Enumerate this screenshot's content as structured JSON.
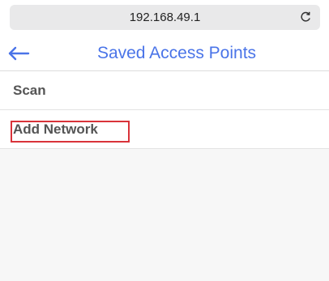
{
  "browser": {
    "url": "192.168.49.1",
    "reload_icon": "reload-icon"
  },
  "header": {
    "back_icon": "left-arrow-icon",
    "title": "Saved Access Points"
  },
  "menu": {
    "items": [
      {
        "label": "Scan"
      },
      {
        "label": "Add Network",
        "highlighted": true
      }
    ]
  },
  "colors": {
    "accent": "#4a74e8",
    "highlight_border": "#d9333a",
    "url_bar_bg": "#e9e9ea",
    "menu_bg": "#f7f7f7",
    "item_text": "#555555"
  }
}
